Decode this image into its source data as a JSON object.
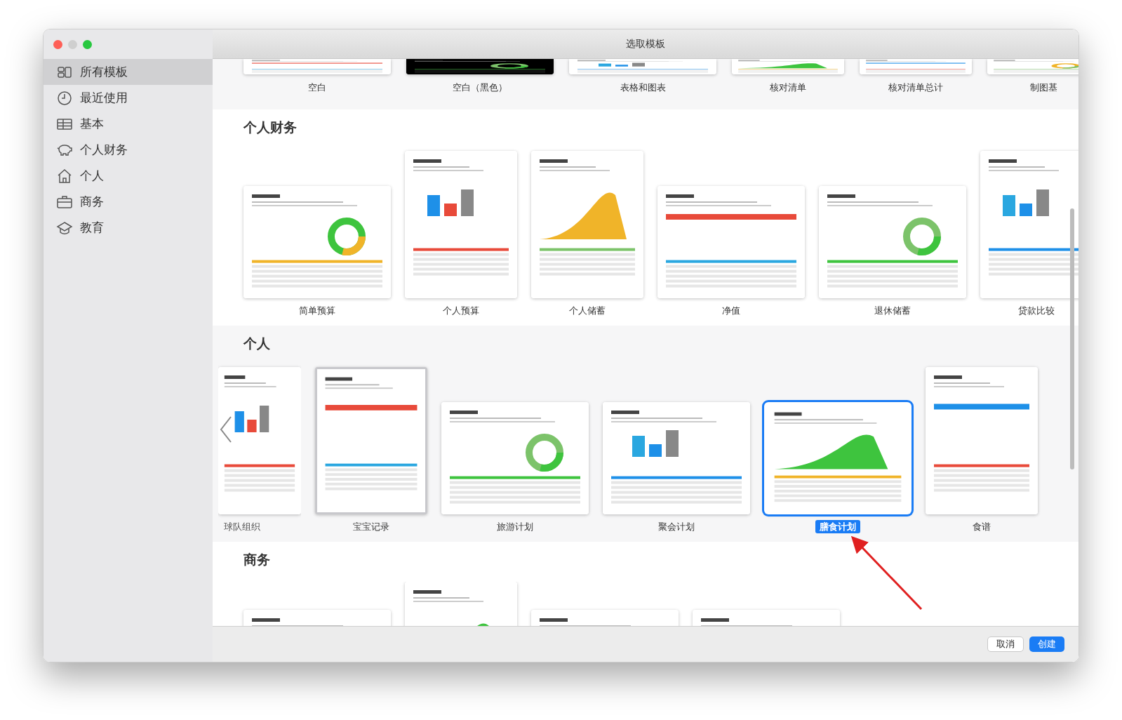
{
  "window": {
    "title": "选取模板"
  },
  "sidebar": {
    "items": [
      {
        "label": "所有模板",
        "selected": true
      },
      {
        "label": "最近使用",
        "selected": false
      },
      {
        "label": "基本",
        "selected": false
      },
      {
        "label": "个人财务",
        "selected": false
      },
      {
        "label": "个人",
        "selected": false
      },
      {
        "label": "商务",
        "selected": false
      },
      {
        "label": "教育",
        "selected": false
      }
    ]
  },
  "top_row": [
    {
      "label": "空白",
      "kind": "landscape",
      "dark": false
    },
    {
      "label": "空白（黑色）",
      "kind": "landscape",
      "dark": true
    },
    {
      "label": "表格和图表",
      "kind": "landscape",
      "dark": false
    },
    {
      "label": "核对清单",
      "kind": "portrait",
      "dark": false
    },
    {
      "label": "核对清单总计",
      "kind": "portrait",
      "dark": false
    },
    {
      "label": "制图基",
      "kind": "portrait",
      "dark": false
    }
  ],
  "sections": [
    {
      "title": "个人财务",
      "templates": [
        {
          "label": "简单预算",
          "kind": "landscape",
          "selected": false,
          "highlighted": false
        },
        {
          "label": "个人预算",
          "kind": "portrait",
          "selected": false,
          "highlighted": false
        },
        {
          "label": "个人储蓄",
          "kind": "portrait",
          "selected": false,
          "highlighted": false
        },
        {
          "label": "净值",
          "kind": "landscape",
          "selected": false,
          "highlighted": false
        },
        {
          "label": "退休储蓄",
          "kind": "landscape",
          "selected": false,
          "highlighted": false
        },
        {
          "label": "贷款比较",
          "kind": "portrait",
          "selected": false,
          "highlighted": false
        }
      ]
    },
    {
      "title": "个人",
      "templates": [
        {
          "label": "球队组织",
          "kind": "portrait",
          "selected": false,
          "highlighted": false
        },
        {
          "label": "宝宝记录",
          "kind": "portrait",
          "selected": false,
          "highlighted": true
        },
        {
          "label": "旅游计划",
          "kind": "landscape",
          "selected": false,
          "highlighted": false
        },
        {
          "label": "聚会计划",
          "kind": "landscape",
          "selected": false,
          "highlighted": false
        },
        {
          "label": "膳食计划",
          "kind": "landscape",
          "selected": true,
          "highlighted": false
        },
        {
          "label": "食谱",
          "kind": "portrait",
          "selected": false,
          "highlighted": false
        }
      ]
    },
    {
      "title": "商务",
      "templates": [
        {
          "kind": "landscape"
        },
        {
          "kind": "portrait"
        },
        {
          "kind": "landscape"
        },
        {
          "kind": "landscape"
        }
      ]
    }
  ],
  "buttons": [
    {
      "label": "取消",
      "primary": false
    },
    {
      "label": "创建",
      "primary": true
    }
  ]
}
